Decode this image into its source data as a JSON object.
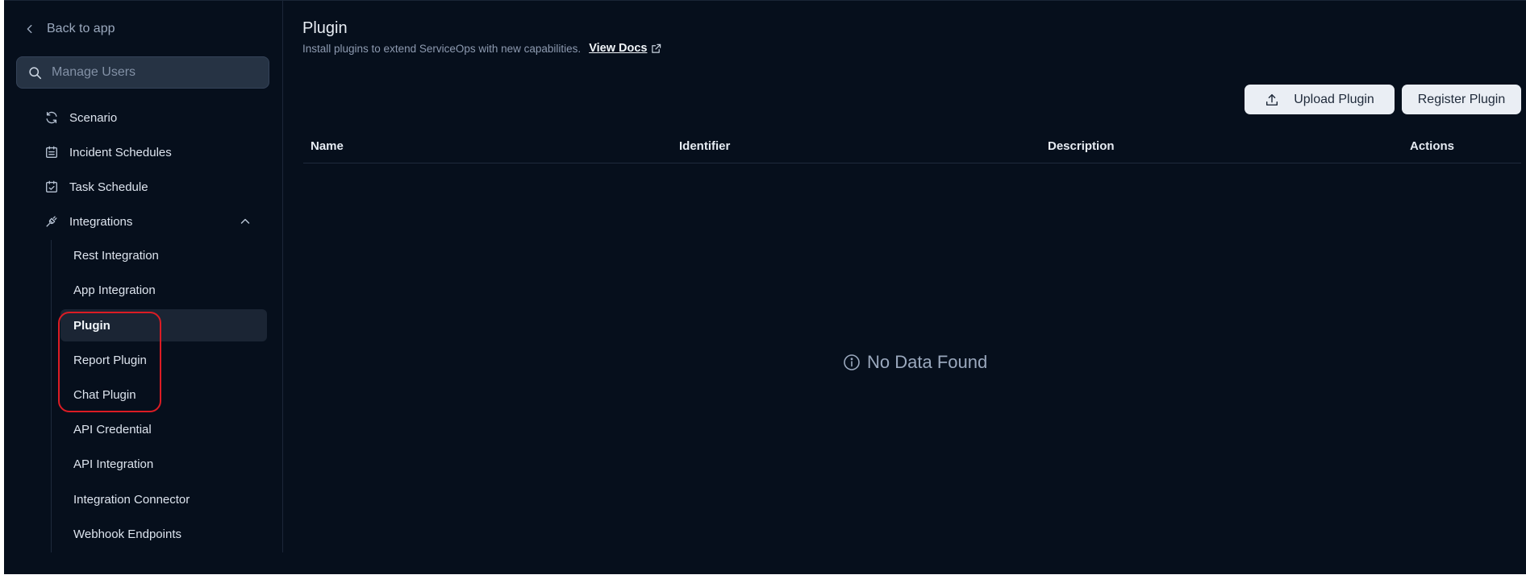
{
  "sidebar": {
    "back_label": "Back to app",
    "search_placeholder": "Manage Users",
    "nav": [
      {
        "label": "Scenario",
        "icon": "refresh-icon"
      },
      {
        "label": "Incident Schedules",
        "icon": "calendar-list-icon"
      },
      {
        "label": "Task Schedule",
        "icon": "calendar-check-icon"
      },
      {
        "label": "Integrations",
        "icon": "plug-icon",
        "expanded": true
      }
    ],
    "sub_items": [
      {
        "label": "Rest Integration"
      },
      {
        "label": "App Integration"
      },
      {
        "label": "Plugin",
        "active": true
      },
      {
        "label": "Report Plugin"
      },
      {
        "label": "Chat Plugin"
      },
      {
        "label": "API Credential"
      },
      {
        "label": "API Integration"
      },
      {
        "label": "Integration Connector"
      },
      {
        "label": "Webhook Endpoints"
      }
    ]
  },
  "main": {
    "title": "Plugin",
    "subtitle": "Install plugins to extend ServiceOps with new capabilities.",
    "docs_link": "View Docs",
    "buttons": {
      "upload": "Upload Plugin",
      "register": "Register Plugin"
    },
    "table": {
      "columns": [
        "Name",
        "Identifier",
        "Description",
        "Actions"
      ],
      "rows": [],
      "empty_text": "No Data Found"
    }
  },
  "colors": {
    "background": "#060f1c",
    "sidebar_active": "#1b2534",
    "button_bg": "#eaeef4",
    "highlight": "#dc1c24"
  }
}
